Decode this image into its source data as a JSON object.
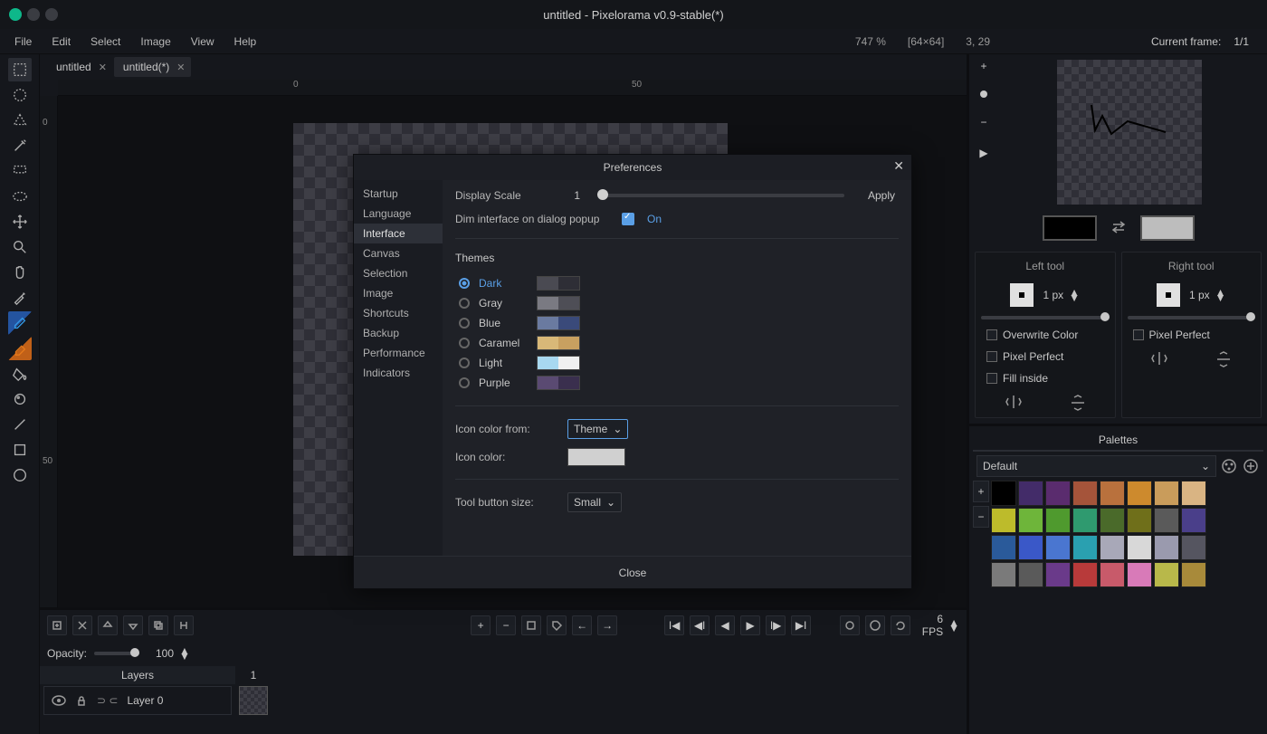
{
  "window": {
    "title": "untitled - Pixelorama v0.9-stable(*)"
  },
  "menu": {
    "items": [
      "File",
      "Edit",
      "Select",
      "Image",
      "View",
      "Help"
    ],
    "zoom": "747 %",
    "dims": "[64×64]",
    "cursor": "3, 29",
    "current_frame_lbl": "Current frame:",
    "current_frame_val": "1/1"
  },
  "tabs": [
    {
      "label": "untitled",
      "active": false
    },
    {
      "label": "untitled(*)",
      "active": true
    }
  ],
  "ruler": {
    "h": [
      "0",
      "50"
    ],
    "v": [
      "0",
      "50"
    ]
  },
  "timeline": {
    "opacity_lbl": "Opacity:",
    "opacity_val": "100",
    "layers_lbl": "Layers",
    "layer0": "Layer 0",
    "frame1": "1",
    "fps": "6 FPS"
  },
  "right": {
    "left_lbl": "Left tool",
    "right_lbl": "Right tool",
    "px": "1 px",
    "overwrite": "Overwrite Color",
    "pixel_perfect": "Pixel Perfect",
    "fill_inside": "Fill inside",
    "palettes_lbl": "Palettes",
    "palette_sel": "Default"
  },
  "palette": [
    "#000000",
    "#432c69",
    "#5a2c6e",
    "#a5543a",
    "#b9713d",
    "#cd8a2d",
    "#c99c5b",
    "#d9b483",
    "#bdbb2b",
    "#6eb53a",
    "#4f9a2e",
    "#2f9a6f",
    "#4a6a2a",
    "#6f6f1a",
    "#5a5a5a",
    "#4a3f8a",
    "#2a5a9a",
    "#3a58c8",
    "#4a76d0",
    "#2aa0b0",
    "#a8a8b8",
    "#d8d8d8",
    "#9a9aae",
    "#555560",
    "#7a7a7a",
    "#5a5a5a",
    "#6a3a8a",
    "#b83a3a",
    "#c85a6a",
    "#d87ab8",
    "#b8b84a",
    "#a88a3a"
  ],
  "prefs": {
    "title": "Preferences",
    "cats": [
      "Startup",
      "Language",
      "Interface",
      "Canvas",
      "Selection",
      "Image",
      "Shortcuts",
      "Backup",
      "Performance",
      "Indicators"
    ],
    "active_cat": "Interface",
    "display_scale_lbl": "Display Scale",
    "display_scale_val": "1",
    "apply": "Apply",
    "dim_lbl": "Dim interface on dialog popup",
    "dim_val": "On",
    "themes_lbl": "Themes",
    "themes": [
      {
        "name": "Dark",
        "c": [
          "#4a4a52",
          "#2e2e36"
        ],
        "on": true
      },
      {
        "name": "Gray",
        "c": [
          "#7a7a82",
          "#4e4e56"
        ],
        "on": false
      },
      {
        "name": "Blue",
        "c": [
          "#6a7aa0",
          "#3a4a7a"
        ],
        "on": false
      },
      {
        "name": "Caramel",
        "c": [
          "#d8b878",
          "#c8a060"
        ],
        "on": false
      },
      {
        "name": "Light",
        "c": [
          "#a8d8f0",
          "#f0f0f0"
        ],
        "on": false
      },
      {
        "name": "Purple",
        "c": [
          "#5a4a72",
          "#3a2f4e"
        ],
        "on": false
      }
    ],
    "icon_from_lbl": "Icon color from:",
    "icon_from_val": "Theme",
    "icon_color_lbl": "Icon color:",
    "icon_color_val": "#d0d0d0",
    "tool_size_lbl": "Tool button size:",
    "tool_size_val": "Small",
    "close": "Close"
  }
}
